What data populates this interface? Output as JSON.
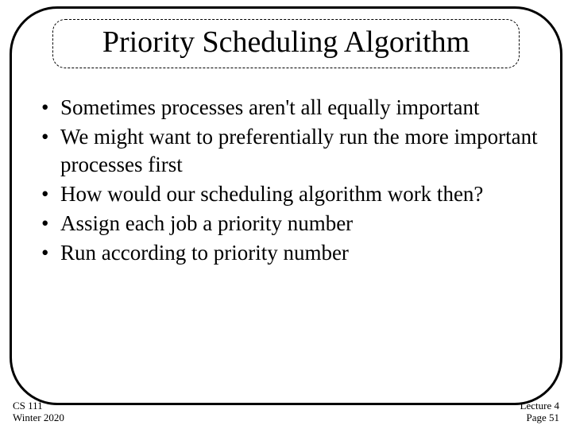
{
  "title": "Priority Scheduling Algorithm",
  "bullets": [
    "Sometimes processes aren't all equally important",
    "We might want to preferentially run the more important processes first",
    "How would our scheduling algorithm work then?",
    "Assign each job a priority number",
    "Run according to priority number"
  ],
  "footer": {
    "course": "CS 111",
    "term": "Winter 2020",
    "lecture": "Lecture 4",
    "page": "Page 51"
  }
}
